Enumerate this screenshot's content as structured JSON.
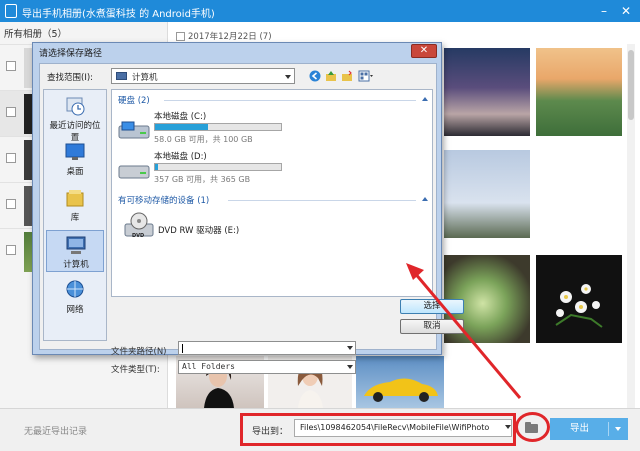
{
  "app": {
    "title": "导出手机相册(水煮蛋科技 的 Android手机)",
    "window_controls": [
      "minimize-icon",
      "close-icon"
    ]
  },
  "sidebar": {
    "all_albums": "所有相册（5）"
  },
  "content": {
    "date_group": "2017年12月22日 (7)"
  },
  "bottom": {
    "no_record": "无最近导出记录",
    "export_to_label": "导出到：",
    "export_path": "Files\\1098462054\\FileRecv\\MobileFile\\WifiPhoto",
    "export_button": "导出"
  },
  "dialog": {
    "title": "请选择保存路径",
    "look_in_label": "查找范围(I):",
    "look_in_value": "计算机",
    "places": [
      {
        "label": "最近访问的位置",
        "icon": "recent-places-icon"
      },
      {
        "label": "桌面",
        "icon": "desktop-icon"
      },
      {
        "label": "库",
        "icon": "libraries-icon"
      },
      {
        "label": "计算机",
        "icon": "computer-icon",
        "selected": true
      },
      {
        "label": "网络",
        "icon": "network-icon"
      }
    ],
    "hard_disk_group": "硬盘 (2)",
    "drives": [
      {
        "name": "本地磁盘 (C:)",
        "size_text": "58.0 GB 可用，共 100 GB",
        "used_fraction": 0.42
      },
      {
        "name": "本地磁盘 (D:)",
        "size_text": "357 GB 可用，共 365 GB",
        "used_fraction": 0.02
      }
    ],
    "removable_group": "有可移动存储的设备 (1)",
    "dvd_drive": "DVD RW 驱动器 (E:)",
    "dvd_badge": "DVD",
    "folder_path_label": "文件夹路径(N)",
    "folder_path_value": "",
    "file_type_label": "文件类型(T):",
    "file_type_value": "All Folders",
    "select_button": "选择",
    "cancel_button": "取消"
  },
  "colors": {
    "title_bar": "#1f8ad9",
    "export_button": "#58aee8",
    "annotation_red": "#e0262a",
    "drive_fill": "#27a0d8"
  }
}
